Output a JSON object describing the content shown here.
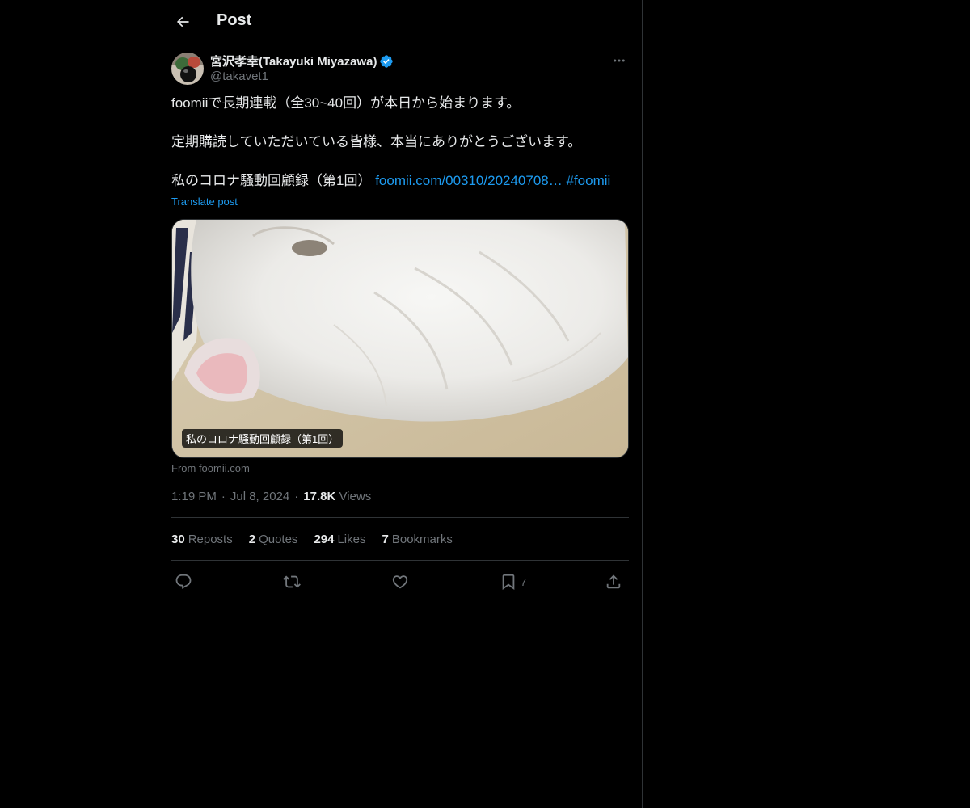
{
  "header": {
    "title": "Post",
    "back_icon": "arrow-left-icon"
  },
  "author": {
    "display_name": "宮沢孝幸(Takayuki Miyazawa)",
    "handle": "@takavet1",
    "verified": true,
    "verified_color": "#1d9bf0"
  },
  "post": {
    "line1": "foomiiで長期連載（全30~40回）が本日から始まります。",
    "line2": "定期購読していただいている皆様、本当にありがとうございます。",
    "line3_text": "私のコロナ騒動回顧録（第1回）",
    "line3_link": "foomii.com/00310/20240708…",
    "line3_hashtag": "#foomii",
    "translate_label": "Translate post"
  },
  "media": {
    "caption": "私のコロナ騒動回顧録（第1回）",
    "source": "From foomii.com"
  },
  "meta": {
    "time": "1:19 PM",
    "date": "Jul 8, 2024",
    "views_count": "17.8K",
    "views_label": "Views"
  },
  "stats": {
    "reposts_count": "30",
    "reposts_label": "Reposts",
    "quotes_count": "2",
    "quotes_label": "Quotes",
    "likes_count": "294",
    "likes_label": "Likes",
    "bookmarks_count": "7",
    "bookmarks_label": "Bookmarks"
  },
  "actions": {
    "bookmark_count": "7"
  },
  "colors": {
    "background": "#000000",
    "text": "#e7e9ea",
    "muted": "#71767b",
    "accent": "#1d9bf0",
    "border": "#2f3336"
  }
}
